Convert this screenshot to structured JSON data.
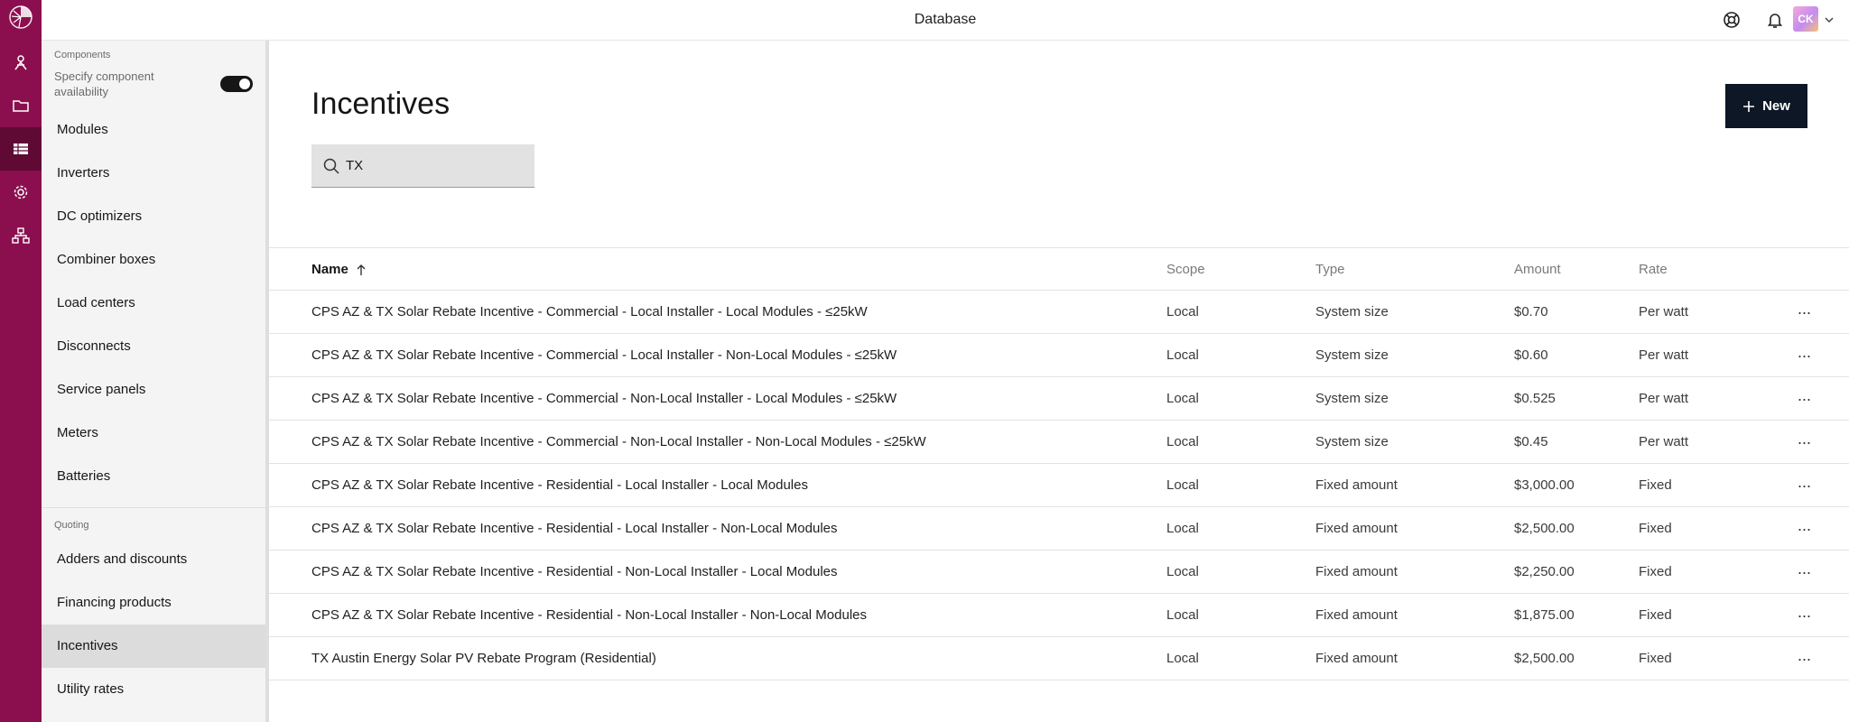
{
  "header": {
    "title": "Database",
    "avatar_initials": "CK"
  },
  "rail": {
    "items": [
      "user-icon",
      "folder-icon",
      "table-icon",
      "gear-icon",
      "sitemap-icon"
    ],
    "active": "table-icon",
    "accent": "#8b0f4f"
  },
  "sidebar": {
    "components_label": "Components",
    "specify_label": "Specify component availability",
    "specify_enabled": true,
    "components": [
      {
        "label": "Modules"
      },
      {
        "label": "Inverters"
      },
      {
        "label": "DC optimizers"
      },
      {
        "label": "Combiner boxes"
      },
      {
        "label": "Load centers"
      },
      {
        "label": "Disconnects"
      },
      {
        "label": "Service panels"
      },
      {
        "label": "Meters"
      },
      {
        "label": "Batteries"
      }
    ],
    "quoting_label": "Quoting",
    "quoting": [
      {
        "label": "Adders and discounts"
      },
      {
        "label": "Financing products"
      },
      {
        "label": "Incentives",
        "active": true
      },
      {
        "label": "Utility rates"
      }
    ]
  },
  "main": {
    "title": "Incentives",
    "new_button": "New",
    "search": {
      "value": "TX",
      "placeholder": ""
    },
    "table": {
      "columns": {
        "name": "Name",
        "scope": "Scope",
        "type": "Type",
        "amount": "Amount",
        "rate": "Rate"
      },
      "sort": "ascending",
      "rows": [
        {
          "name": "CPS AZ & TX Solar Rebate Incentive - Commercial - Local Installer - Local Modules - ≤25kW",
          "scope": "Local",
          "type": "System size",
          "amount": "$0.70",
          "rate": "Per watt"
        },
        {
          "name": "CPS AZ & TX Solar Rebate Incentive - Commercial - Local Installer - Non-Local Modules - ≤25kW",
          "scope": "Local",
          "type": "System size",
          "amount": "$0.60",
          "rate": "Per watt"
        },
        {
          "name": "CPS AZ & TX Solar Rebate Incentive - Commercial - Non-Local Installer - Local Modules - ≤25kW",
          "scope": "Local",
          "type": "System size",
          "amount": "$0.525",
          "rate": "Per watt"
        },
        {
          "name": "CPS AZ & TX Solar Rebate Incentive - Commercial - Non-Local Installer - Non-Local Modules - ≤25kW",
          "scope": "Local",
          "type": "System size",
          "amount": "$0.45",
          "rate": "Per watt"
        },
        {
          "name": "CPS AZ & TX Solar Rebate Incentive - Residential - Local Installer - Local Modules",
          "scope": "Local",
          "type": "Fixed amount",
          "amount": "$3,000.00",
          "rate": "Fixed"
        },
        {
          "name": "CPS AZ & TX Solar Rebate Incentive - Residential - Local Installer - Non-Local Modules",
          "scope": "Local",
          "type": "Fixed amount",
          "amount": "$2,500.00",
          "rate": "Fixed"
        },
        {
          "name": "CPS AZ & TX Solar Rebate Incentive - Residential - Non-Local Installer - Local Modules",
          "scope": "Local",
          "type": "Fixed amount",
          "amount": "$2,250.00",
          "rate": "Fixed"
        },
        {
          "name": "CPS AZ & TX Solar Rebate Incentive - Residential - Non-Local Installer - Non-Local Modules",
          "scope": "Local",
          "type": "Fixed amount",
          "amount": "$1,875.00",
          "rate": "Fixed"
        },
        {
          "name": "TX Austin Energy Solar PV Rebate Program (Residential)",
          "scope": "Local",
          "type": "Fixed amount",
          "amount": "$2,500.00",
          "rate": "Fixed"
        }
      ]
    }
  }
}
